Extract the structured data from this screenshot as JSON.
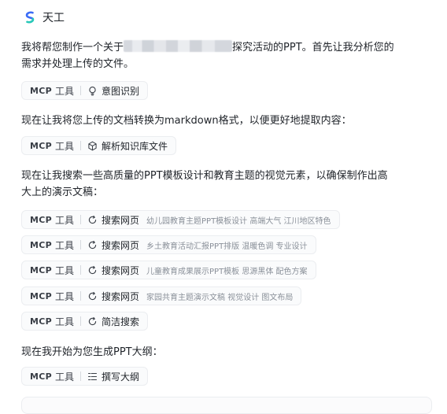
{
  "app": {
    "name": "天工"
  },
  "messages": {
    "m1_prefix": "我将帮您制作一个关于",
    "m1_suffix": "探究活动的PPT。首先让我分析您的",
    "m1_line2": "需求并处理上传的文件。",
    "m2": "现在让我将您上传的文档转换为markdown格式，以便更好地提取内容：",
    "m3_line1": "现在让我搜索一些高质量的PPT模板设计和教育主题的视觉元素，以确保制作出高",
    "m3_line2": "大上的演示文稿：",
    "m4": "现在我开始为您生成PPT大纲："
  },
  "tool_badge": {
    "mcp": "MCP",
    "tool": "工具"
  },
  "chips": [
    {
      "icon": "lightbulb-icon",
      "action": "意图识别",
      "query": ""
    },
    {
      "icon": "cube-icon",
      "action": "解析知识库文件",
      "query": ""
    },
    {
      "icon": "refresh-search-icon",
      "action": "搜索网页",
      "query": "幼儿园教育主题PPT模板设计 高端大气 江川地区特色"
    },
    {
      "icon": "refresh-search-icon",
      "action": "搜索网页",
      "query": "乡土教育活动汇报PPT排版 温暖色调 专业设计"
    },
    {
      "icon": "refresh-search-icon",
      "action": "搜索网页",
      "query": "儿童教育成果展示PPT模板 思源黑体 配色方案"
    },
    {
      "icon": "refresh-search-icon",
      "action": "搜索网页",
      "query": "家园共育主题演示文稿 视觉设计 图文布局"
    },
    {
      "icon": "refresh-search-icon",
      "action": "简洁搜索",
      "query": ""
    },
    {
      "icon": "outline-list-icon",
      "action": "撰写大纲",
      "query": ""
    }
  ],
  "colors": {
    "text": "#1f2329",
    "muted": "#8a9099",
    "chip_border": "#ebedf0",
    "chip_bg": "#fafbfc"
  }
}
